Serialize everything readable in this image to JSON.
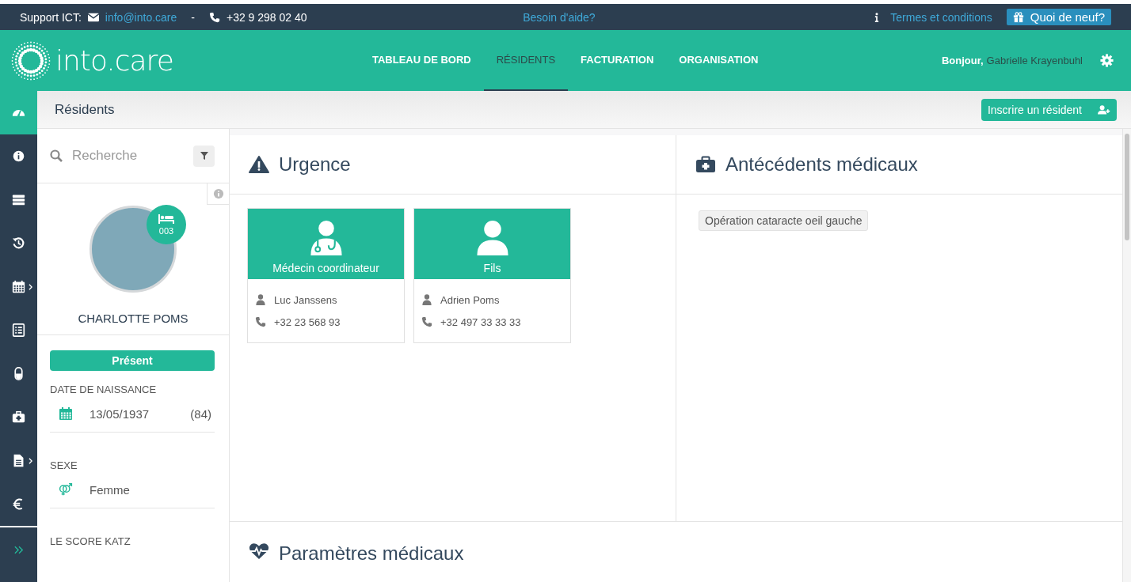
{
  "top_bar": {
    "support_label": "Support ICT:",
    "email": "info@into.care",
    "separator": "-",
    "phone": "+32 9 298 02 40",
    "help_link": "Besoin d'aide?",
    "terms_link": "Termes et conditions",
    "news_button": "Quoi de neuf?"
  },
  "header": {
    "logo": "into.care",
    "nav": [
      {
        "label": "TABLEAU DE BORD",
        "selected": false
      },
      {
        "label": "RÉSIDENTS",
        "selected": true
      },
      {
        "label": "FACTURATION",
        "selected": false
      },
      {
        "label": "ORGANISATION",
        "selected": false
      }
    ],
    "greeting": "Bonjour,",
    "user": "Gabrielle Krayenbuhl"
  },
  "sidebar": {
    "items": [
      {
        "selected": true,
        "submenu": false
      },
      {
        "selected": false,
        "submenu": false
      },
      {
        "selected": false,
        "submenu": false
      },
      {
        "selected": false,
        "submenu": false
      },
      {
        "selected": false,
        "submenu": true
      },
      {
        "selected": false,
        "submenu": false
      },
      {
        "selected": false,
        "submenu": false
      },
      {
        "selected": false,
        "submenu": false
      },
      {
        "selected": false,
        "submenu": true
      },
      {
        "selected": false,
        "submenu": false
      }
    ]
  },
  "page": {
    "title": "Résidents",
    "add_button": "Inscrire un résident"
  },
  "resident_panel": {
    "search_placeholder": "Recherche",
    "room": "003",
    "name": "CHARLOTTE POMS",
    "status": "Présent",
    "fields": [
      {
        "kind": "date",
        "label": "DATE DE NAISSANCE",
        "value": "13/05/1937",
        "extra": "(84)"
      },
      {
        "kind": "gender",
        "label": "SEXE",
        "value": "Femme"
      },
      {
        "kind": "heading",
        "label": "LE SCORE KATZ"
      }
    ]
  },
  "urgence": {
    "title": "Urgence",
    "contacts": [
      {
        "kind": "doctor",
        "role": "Médecin coordinateur",
        "name": "Luc Janssens",
        "phone": "+32 23 568 93"
      },
      {
        "kind": "person",
        "role": "Fils",
        "name": "Adrien Poms",
        "phone": "+32 497 33 33 33"
      }
    ]
  },
  "antecedents": {
    "title": "Antécédents médicaux",
    "tags": [
      "Opération cataracte oeil gauche"
    ]
  },
  "parametres": {
    "title": "Paramètres médicaux"
  }
}
